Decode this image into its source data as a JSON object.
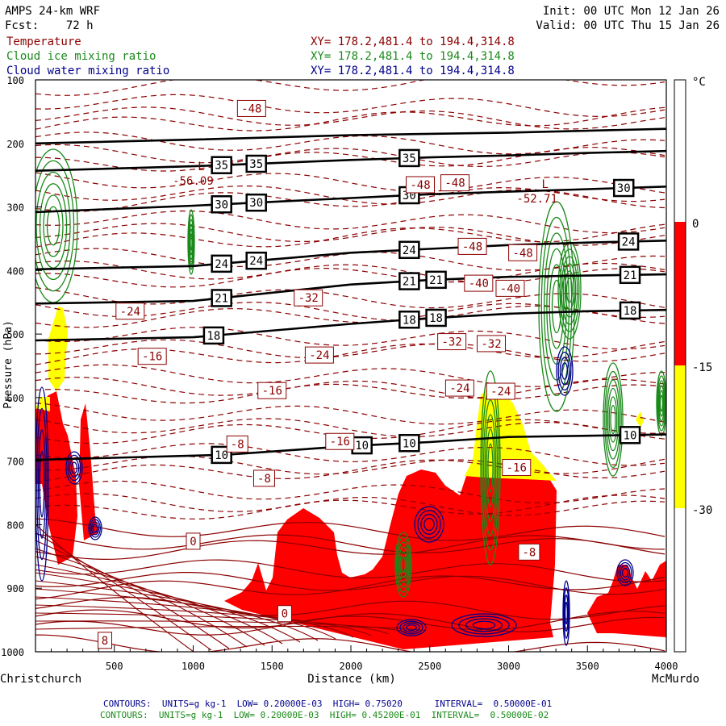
{
  "header": {
    "title_line1": "AMPS 24-km WRF",
    "title_line2": "Fcst:    72 h",
    "init": "Init: 00 UTC Mon 12 Jan 26",
    "valid": "Valid: 00 UTC Thu 15 Jan 26"
  },
  "fields": [
    {
      "name": "Temperature",
      "xy": "XY= 178.2,481.4 to 194.4,314.8",
      "color": "#8b0000"
    },
    {
      "name": "Cloud ice mixing ratio",
      "xy": "XY= 178.2,481.4 to 194.4,314.8",
      "color": "#1a8a1a"
    },
    {
      "name": "Cloud water mixing ratio",
      "xy": "XY= 178.2,481.4 to 194.4,314.8",
      "color": "#00008b"
    }
  ],
  "colorbar": {
    "unit": "°C",
    "ticks": [
      "0",
      "-15",
      "-30"
    ],
    "colors": {
      "above_0": "#ffffff",
      "0_to_-15": "#ff0000",
      "-15_to_-30": "#ffff00",
      "below_-30": "#ffffff"
    }
  },
  "footer": {
    "line1": "CONTOURS:  UNITS=g kg-1  LOW= 0.20000E-03  HIGH= 0.75020      INTERVAL=  0.50000E-01",
    "line2": "CONTOURS:  UNITS=g kg-1  LOW= 0.20000E-03  HIGH= 0.45200E-01  INTERVAL=  0.50000E-02"
  },
  "chart_data": {
    "type": "contour-cross-section",
    "xlabel": "Distance (km)",
    "ylabel": "Pressure (hPa)",
    "x_start_label": "Christchurch",
    "x_end_label": "McMurdo",
    "xlim": [
      0,
      4000
    ],
    "ylim": [
      1000,
      100
    ],
    "x_ticks": [
      500,
      1000,
      1500,
      2000,
      2500,
      3000,
      3500,
      4000
    ],
    "y_ticks": [
      100,
      200,
      300,
      400,
      500,
      600,
      700,
      800,
      900,
      1000
    ],
    "theta_lines": [
      {
        "label": "10",
        "points": [
          [
            0,
            698
          ],
          [
            1200,
            690
          ],
          [
            2000,
            676
          ],
          [
            2500,
            670
          ],
          [
            3000,
            662
          ],
          [
            3500,
            660
          ],
          [
            4000,
            658
          ]
        ],
        "label_x": [
          1180,
          2070,
          2370,
          3770
        ]
      },
      {
        "label": "18",
        "points": [
          [
            0,
            510
          ],
          [
            1000,
            505
          ],
          [
            2000,
            484
          ],
          [
            2500,
            475
          ],
          [
            3000,
            468
          ],
          [
            3500,
            464
          ],
          [
            4000,
            462
          ]
        ],
        "label_x": [
          1130,
          2370,
          2540,
          3770
        ]
      },
      {
        "label": "21",
        "points": [
          [
            0,
            452
          ],
          [
            1000,
            448
          ],
          [
            2000,
            422
          ],
          [
            2500,
            415
          ],
          [
            3000,
            410
          ],
          [
            3500,
            408
          ],
          [
            4000,
            406
          ]
        ],
        "label_x": [
          1180,
          2370,
          2540,
          3770
        ]
      },
      {
        "label": "24",
        "points": [
          [
            0,
            398
          ],
          [
            1000,
            393
          ],
          [
            2000,
            372
          ],
          [
            2500,
            366
          ],
          [
            3000,
            360
          ],
          [
            3500,
            356
          ],
          [
            4000,
            353
          ]
        ],
        "label_x": [
          1180,
          1400,
          2370,
          3760
        ]
      },
      {
        "label": "30",
        "points": [
          [
            0,
            308
          ],
          [
            1000,
            298
          ],
          [
            2000,
            286
          ],
          [
            2500,
            280
          ],
          [
            3000,
            276
          ],
          [
            3500,
            272
          ],
          [
            4000,
            268
          ]
        ],
        "label_x": [
          1180,
          1400,
          2370,
          3730
        ]
      },
      {
        "label": "35",
        "points": [
          [
            0,
            243
          ],
          [
            1000,
            236
          ],
          [
            2000,
            226
          ],
          [
            2500,
            222
          ],
          [
            3000,
            219
          ],
          [
            3500,
            215
          ],
          [
            4000,
            212
          ]
        ],
        "label_x": [
          1180,
          1400,
          2370
        ]
      },
      {
        "label": "",
        "points": [
          [
            0,
            200
          ],
          [
            1000,
            194
          ],
          [
            2000,
            187
          ],
          [
            3000,
            183
          ],
          [
            4000,
            177
          ]
        ],
        "label_x": []
      }
    ],
    "temperature_labels": [
      {
        "v": "-48",
        "x": 1370,
        "p": 145
      },
      {
        "v": "-48",
        "x": 2440,
        "p": 265
      },
      {
        "v": "-48",
        "x": 2660,
        "p": 262
      },
      {
        "v": "-48",
        "x": 2770,
        "p": 362
      },
      {
        "v": "-48",
        "x": 3090,
        "p": 372
      },
      {
        "v": "-40",
        "x": 2810,
        "p": 420
      },
      {
        "v": "-40",
        "x": 3010,
        "p": 428
      },
      {
        "v": "-32",
        "x": 1730,
        "p": 443
      },
      {
        "v": "-32",
        "x": 2640,
        "p": 512
      },
      {
        "v": "-32",
        "x": 2890,
        "p": 515
      },
      {
        "v": "-24",
        "x": 600,
        "p": 464
      },
      {
        "v": "-24",
        "x": 1800,
        "p": 533
      },
      {
        "v": "-24",
        "x": 2690,
        "p": 585
      },
      {
        "v": "-24",
        "x": 2950,
        "p": 590
      },
      {
        "v": "-16",
        "x": 740,
        "p": 535
      },
      {
        "v": "-16",
        "x": 1500,
        "p": 589
      },
      {
        "v": "-16",
        "x": 1930,
        "p": 669
      },
      {
        "v": "-16",
        "x": 3050,
        "p": 710
      },
      {
        "v": "-8",
        "x": 1280,
        "p": 673
      },
      {
        "v": "-8",
        "x": 1450,
        "p": 727
      },
      {
        "v": "-8",
        "x": 3130,
        "p": 843
      },
      {
        "v": "0",
        "x": 1000,
        "p": 826
      },
      {
        "v": "0",
        "x": 1580,
        "p": 940
      },
      {
        "v": "8",
        "x": 440,
        "p": 982
      }
    ],
    "min_labels": [
      {
        "v": "-56.09",
        "x": 1000,
        "p": 260
      },
      {
        "v": "-52.71",
        "x": 3180,
        "p": 288
      }
    ]
  }
}
